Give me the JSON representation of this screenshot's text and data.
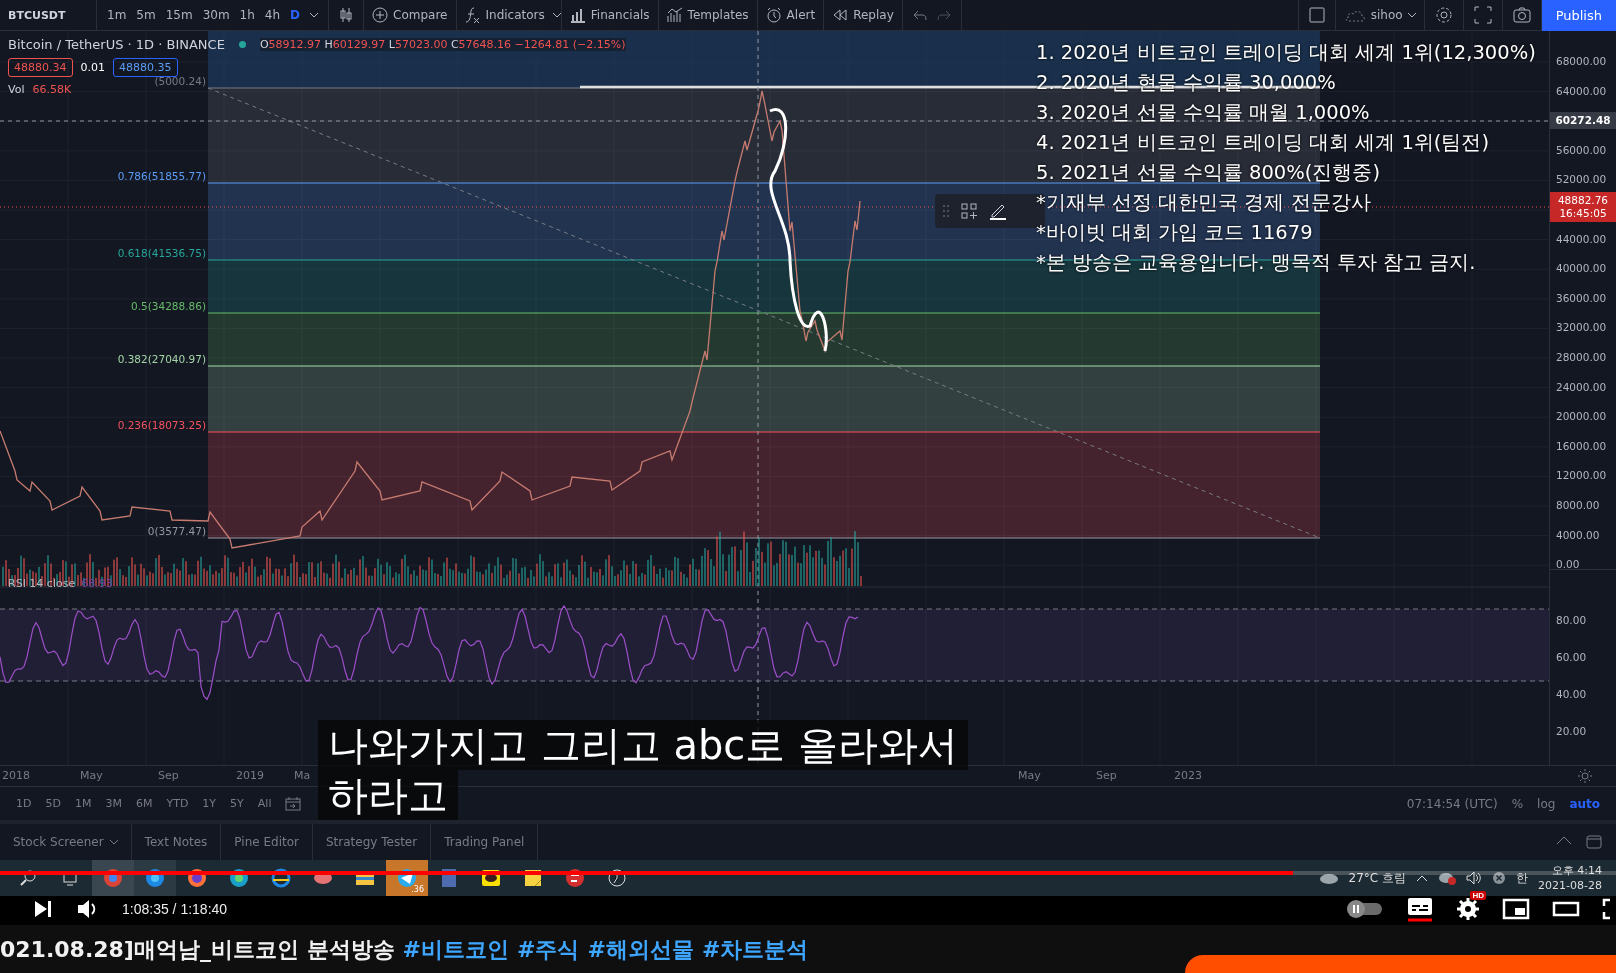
{
  "toolbar": {
    "symbol": "BTCUSDT",
    "intervals": [
      {
        "label": "1m",
        "selected": false
      },
      {
        "label": "5m",
        "selected": false
      },
      {
        "label": "15m",
        "selected": false
      },
      {
        "label": "30m",
        "selected": false
      },
      {
        "label": "1h",
        "selected": false
      },
      {
        "label": "4h",
        "selected": false
      },
      {
        "label": "D",
        "selected": true
      }
    ],
    "buttons": [
      {
        "kind": "compare",
        "label": "Compare"
      },
      {
        "kind": "indicators",
        "label": "Indicators"
      },
      {
        "kind": "financials",
        "label": "Financials"
      },
      {
        "kind": "templates",
        "label": "Templates"
      },
      {
        "kind": "alert",
        "label": "Alert"
      },
      {
        "kind": "replay",
        "label": "Replay"
      }
    ],
    "user": "sihoo",
    "publish": "Publish"
  },
  "legend": {
    "title": "Bitcoin / TetherUS · 1D · BINANCE",
    "ohlc": [
      {
        "key": "O",
        "value": "58912.97"
      },
      {
        "key": "H",
        "value": "60129.97"
      },
      {
        "key": "L",
        "value": "57023.00"
      },
      {
        "key": "C",
        "value": "57648.16"
      }
    ],
    "change": "−1264.81 (−2.15%)",
    "sell": "48880.34",
    "spread": "0.01",
    "buy": "48880.35",
    "volume_label": "Vol",
    "volume": "66.58K"
  },
  "fib_levels": [
    {
      "label": "(5000.24)",
      "color": "#787b86"
    },
    {
      "label": "0.786(51855.77)",
      "color": "#5b9cf6"
    },
    {
      "label": "0.618(41536.75)",
      "color": "#26a69a"
    },
    {
      "label": "0.5(34288.86)",
      "color": "#66bb6a"
    },
    {
      "label": "0.382(27040.97)",
      "color": "#a5d6a7"
    },
    {
      "label": "0.236(18073.25)",
      "color": "#f7525f"
    },
    {
      "label": "0(3577.47)",
      "color": "#9598a1"
    }
  ],
  "announcement": [
    "1. 2020년 비트코인 트레이딩 대회 세계 1위(12,300%)",
    "2. 2020년 현물 수익률 30,000%",
    "3. 2020년 선물 수익률 매월 1,000%",
    "4. 2021년 비트코인 트레이딩 대회 세계 1위(팀전)",
    "5. 2021년 선물 수익률 800%(진행중)",
    "*기재부 선정 대한민국 경제 전문강사",
    "*바이빗 대회 가입 코드 11679",
    "*본 방송은 교육용입니다. 맹목적 투자 참고 금지."
  ],
  "price_axis": [
    "68000.00",
    "64000.00",
    "56000.00",
    "52000.00",
    "44000.00",
    "40000.00",
    "36000.00",
    "32000.00",
    "28000.00",
    "24000.00",
    "20000.00",
    "16000.00",
    "12000.00",
    "8000.00",
    "4000.00",
    "0.00"
  ],
  "crosshair_price": "60272.48",
  "last_price": {
    "price": "48882.76",
    "countdown": "16:45:05"
  },
  "rsi": {
    "label": "RSI 14 close",
    "value": "68.93",
    "axis": [
      "80.00",
      "60.00",
      "40.00",
      "20.00"
    ]
  },
  "time_axis": [
    "2018",
    "May",
    "Sep",
    "2019",
    "Ma",
    "May",
    "Sep",
    "2023"
  ],
  "range_bar": {
    "ranges": [
      "1D",
      "5D",
      "1M",
      "3M",
      "6M",
      "YTD",
      "1Y",
      "5Y",
      "All"
    ],
    "time": "07:14:54 (UTC)",
    "options": [
      {
        "label": "%",
        "selected": false
      },
      {
        "label": "log",
        "selected": false
      },
      {
        "label": "auto",
        "selected": true
      }
    ]
  },
  "bottom_tabs": [
    "Stock Screener",
    "Text Notes",
    "Pine Editor",
    "Strategy Tester",
    "Trading Panel"
  ],
  "taskbar": {
    "badge": ".36",
    "weather": "27°C 흐림",
    "ime": "한",
    "time": "오후 4:14",
    "date": "2021-08-28"
  },
  "subtitle": [
    "나와가지고 그리고 abc로 올라와서",
    "하라고"
  ],
  "player": {
    "level": 0.8,
    "time": "1:08:35 / 1:18:40",
    "captions_on": true,
    "hd": "HD"
  },
  "video_title": {
    "text": "021.08.28]매억남_비트코인 분석방송",
    "tags": [
      "#비트코인",
      "#주식",
      "#해외선물",
      "#차트분석"
    ]
  }
}
